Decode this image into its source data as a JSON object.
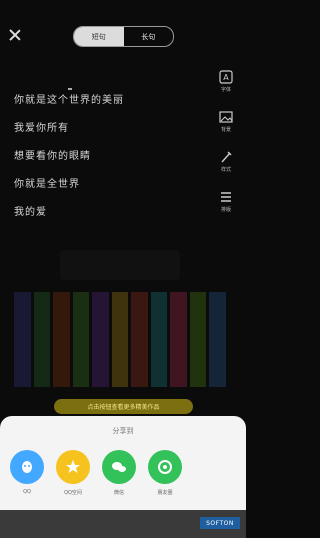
{
  "header": {
    "tab_active": "短句",
    "tab_inactive": "长句"
  },
  "side_rail": [
    {
      "icon": "font-icon",
      "label": "字体"
    },
    {
      "icon": "image-icon",
      "label": "背景"
    },
    {
      "icon": "brush-icon",
      "label": "样式"
    },
    {
      "icon": "align-icon",
      "label": "排版"
    }
  ],
  "poem_lines": [
    "你就是这个世界的美丽",
    "我爱你所有",
    "想要看你的眼睛",
    "你就是全世界",
    "我的爱"
  ],
  "banner_text": "点击按钮查看更多精美作品",
  "share_sheet": {
    "title": "分享到",
    "items": [
      {
        "name": "QQ",
        "color": "#43a8ff"
      },
      {
        "name": "QQ空间",
        "color": "#f6c21d"
      },
      {
        "name": "微信",
        "color": "#33c15a"
      },
      {
        "name": "朋友圈",
        "color": "#33c15a"
      }
    ]
  },
  "watermark": "SOFTON"
}
